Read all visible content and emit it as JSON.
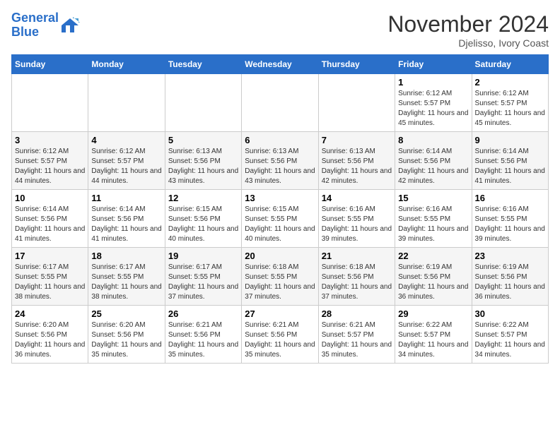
{
  "header": {
    "logo_line1": "General",
    "logo_line2": "Blue",
    "month": "November 2024",
    "location": "Djelisso, Ivory Coast"
  },
  "days_of_week": [
    "Sunday",
    "Monday",
    "Tuesday",
    "Wednesday",
    "Thursday",
    "Friday",
    "Saturday"
  ],
  "weeks": [
    [
      {
        "day": "",
        "info": ""
      },
      {
        "day": "",
        "info": ""
      },
      {
        "day": "",
        "info": ""
      },
      {
        "day": "",
        "info": ""
      },
      {
        "day": "",
        "info": ""
      },
      {
        "day": "1",
        "info": "Sunrise: 6:12 AM\nSunset: 5:57 PM\nDaylight: 11 hours and 45 minutes."
      },
      {
        "day": "2",
        "info": "Sunrise: 6:12 AM\nSunset: 5:57 PM\nDaylight: 11 hours and 45 minutes."
      }
    ],
    [
      {
        "day": "3",
        "info": "Sunrise: 6:12 AM\nSunset: 5:57 PM\nDaylight: 11 hours and 44 minutes."
      },
      {
        "day": "4",
        "info": "Sunrise: 6:12 AM\nSunset: 5:57 PM\nDaylight: 11 hours and 44 minutes."
      },
      {
        "day": "5",
        "info": "Sunrise: 6:13 AM\nSunset: 5:56 PM\nDaylight: 11 hours and 43 minutes."
      },
      {
        "day": "6",
        "info": "Sunrise: 6:13 AM\nSunset: 5:56 PM\nDaylight: 11 hours and 43 minutes."
      },
      {
        "day": "7",
        "info": "Sunrise: 6:13 AM\nSunset: 5:56 PM\nDaylight: 11 hours and 42 minutes."
      },
      {
        "day": "8",
        "info": "Sunrise: 6:14 AM\nSunset: 5:56 PM\nDaylight: 11 hours and 42 minutes."
      },
      {
        "day": "9",
        "info": "Sunrise: 6:14 AM\nSunset: 5:56 PM\nDaylight: 11 hours and 41 minutes."
      }
    ],
    [
      {
        "day": "10",
        "info": "Sunrise: 6:14 AM\nSunset: 5:56 PM\nDaylight: 11 hours and 41 minutes."
      },
      {
        "day": "11",
        "info": "Sunrise: 6:14 AM\nSunset: 5:56 PM\nDaylight: 11 hours and 41 minutes."
      },
      {
        "day": "12",
        "info": "Sunrise: 6:15 AM\nSunset: 5:56 PM\nDaylight: 11 hours and 40 minutes."
      },
      {
        "day": "13",
        "info": "Sunrise: 6:15 AM\nSunset: 5:55 PM\nDaylight: 11 hours and 40 minutes."
      },
      {
        "day": "14",
        "info": "Sunrise: 6:16 AM\nSunset: 5:55 PM\nDaylight: 11 hours and 39 minutes."
      },
      {
        "day": "15",
        "info": "Sunrise: 6:16 AM\nSunset: 5:55 PM\nDaylight: 11 hours and 39 minutes."
      },
      {
        "day": "16",
        "info": "Sunrise: 6:16 AM\nSunset: 5:55 PM\nDaylight: 11 hours and 39 minutes."
      }
    ],
    [
      {
        "day": "17",
        "info": "Sunrise: 6:17 AM\nSunset: 5:55 PM\nDaylight: 11 hours and 38 minutes."
      },
      {
        "day": "18",
        "info": "Sunrise: 6:17 AM\nSunset: 5:55 PM\nDaylight: 11 hours and 38 minutes."
      },
      {
        "day": "19",
        "info": "Sunrise: 6:17 AM\nSunset: 5:55 PM\nDaylight: 11 hours and 37 minutes."
      },
      {
        "day": "20",
        "info": "Sunrise: 6:18 AM\nSunset: 5:55 PM\nDaylight: 11 hours and 37 minutes."
      },
      {
        "day": "21",
        "info": "Sunrise: 6:18 AM\nSunset: 5:56 PM\nDaylight: 11 hours and 37 minutes."
      },
      {
        "day": "22",
        "info": "Sunrise: 6:19 AM\nSunset: 5:56 PM\nDaylight: 11 hours and 36 minutes."
      },
      {
        "day": "23",
        "info": "Sunrise: 6:19 AM\nSunset: 5:56 PM\nDaylight: 11 hours and 36 minutes."
      }
    ],
    [
      {
        "day": "24",
        "info": "Sunrise: 6:20 AM\nSunset: 5:56 PM\nDaylight: 11 hours and 36 minutes."
      },
      {
        "day": "25",
        "info": "Sunrise: 6:20 AM\nSunset: 5:56 PM\nDaylight: 11 hours and 35 minutes."
      },
      {
        "day": "26",
        "info": "Sunrise: 6:21 AM\nSunset: 5:56 PM\nDaylight: 11 hours and 35 minutes."
      },
      {
        "day": "27",
        "info": "Sunrise: 6:21 AM\nSunset: 5:56 PM\nDaylight: 11 hours and 35 minutes."
      },
      {
        "day": "28",
        "info": "Sunrise: 6:21 AM\nSunset: 5:57 PM\nDaylight: 11 hours and 35 minutes."
      },
      {
        "day": "29",
        "info": "Sunrise: 6:22 AM\nSunset: 5:57 PM\nDaylight: 11 hours and 34 minutes."
      },
      {
        "day": "30",
        "info": "Sunrise: 6:22 AM\nSunset: 5:57 PM\nDaylight: 11 hours and 34 minutes."
      }
    ]
  ]
}
